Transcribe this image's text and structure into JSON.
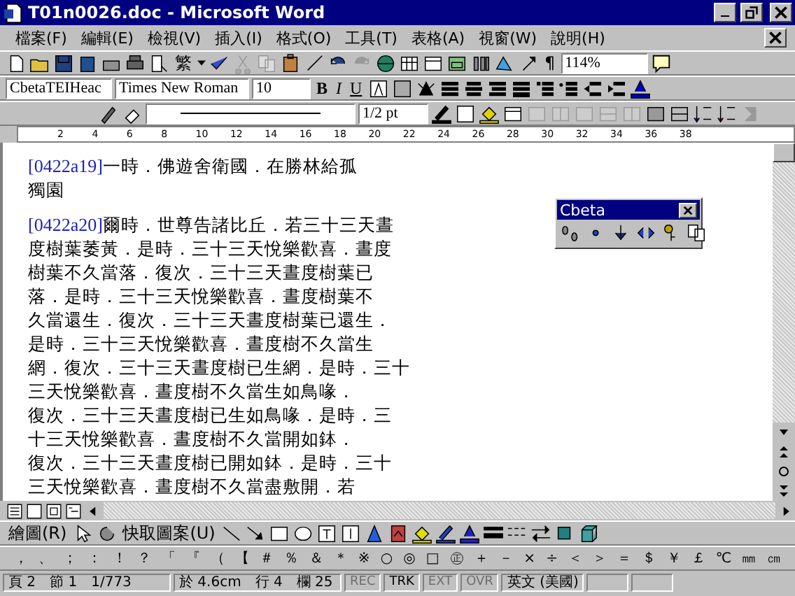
{
  "window": {
    "title": "T01n0026.doc - Microsoft Word"
  },
  "menu": [
    {
      "label": "檔案(F)"
    },
    {
      "label": "編輯(E)"
    },
    {
      "label": "檢視(V)"
    },
    {
      "label": "插入(I)"
    },
    {
      "label": "格式(O)"
    },
    {
      "label": "工具(T)"
    },
    {
      "label": "表格(A)"
    },
    {
      "label": "視窗(W)"
    },
    {
      "label": "說明(H)"
    }
  ],
  "standard_toolbar": {
    "script_button": "繁",
    "paragraph_mark": "¶",
    "zoom": "114%"
  },
  "formatting_toolbar": {
    "style": "CbetaTEIHeac",
    "font": "Times New Roman",
    "size": "10",
    "bold": "B",
    "italic": "I",
    "underline": "U"
  },
  "borders_toolbar": {
    "line_weight": "1/2 pt"
  },
  "ruler": {
    "ticks": [
      "2",
      "4",
      "6",
      "8",
      "10",
      "12",
      "14",
      "16",
      "18",
      "20",
      "22",
      "24",
      "26",
      "28",
      "30",
      "32",
      "34",
      "36",
      "38"
    ]
  },
  "document": {
    "paragraphs": [
      {
        "ref": "[0422a19]",
        "lines": [
          "一時．佛遊舍衛國．在勝林給孤",
          "獨園"
        ]
      },
      {
        "ref": "[0422a20]",
        "lines": [
          "爾時．世尊告諸比丘．若三十三天晝",
          "度樹葉萎黃．是時．三十三天悅樂歡喜．晝度",
          "樹葉不久當落．復次．三十三天晝度樹葉已",
          "落．是時．三十三天悅樂歡喜．晝度樹葉不",
          "久當還生．復次．三十三天晝度樹葉已還生．",
          "是時．三十三天悅樂歡喜．晝度樹不久當生",
          "網．復次．三十三天晝度樹已生網．是時．三十",
          "三天悅樂歡喜．晝度樹不久當生如鳥喙．",
          "復次．三十三天晝度樹已生如鳥喙．是時．三",
          "十三天悅樂歡喜．晝度樹不久當開如鉢．",
          "復次．三十三天晝度樹已開如鉢．是時．三十",
          "三天悅樂歡喜．晝度樹不久當盡敷開．若"
        ]
      }
    ]
  },
  "cbeta_toolbar": {
    "title": "Cbeta"
  },
  "drawing_toolbar": {
    "draw_menu": "繪圖(R)",
    "autoshapes_menu": "快取圖案(U)"
  },
  "symbol_toolbar": {
    "symbols": [
      "，",
      "、",
      "；",
      "：",
      "！",
      "？",
      "「",
      "『",
      "（",
      "【",
      "＃",
      "％",
      "＆",
      "＊",
      "※",
      "○",
      "◎",
      "□",
      "㊣",
      "＋",
      "－",
      "×",
      "÷",
      "＜",
      "＞",
      "＝",
      "＄",
      "￥",
      "￡",
      "℃",
      "㎜",
      "㎝"
    ]
  },
  "status_bar": {
    "page": "頁 2",
    "section": "節 1",
    "pages": "1/773",
    "at": "於 4.6cm",
    "line": "行 4",
    "column": "欄 25",
    "indicators": [
      {
        "label": "REC",
        "enabled": false
      },
      {
        "label": "TRK",
        "enabled": true
      },
      {
        "label": "EXT",
        "enabled": false
      },
      {
        "label": "OVR",
        "enabled": false
      }
    ],
    "language": "英文 (美國)"
  }
}
